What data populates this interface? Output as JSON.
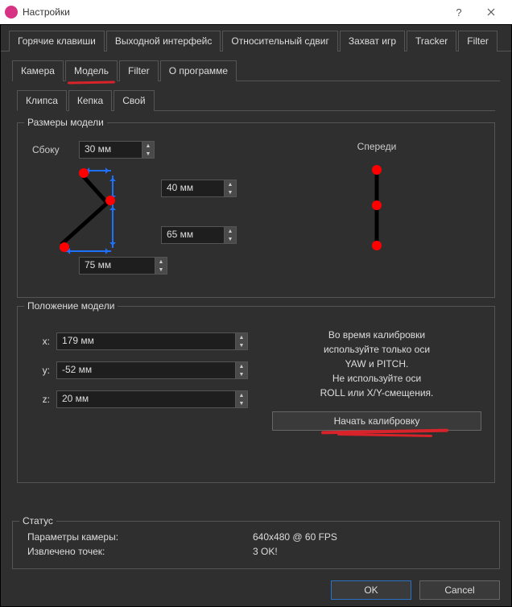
{
  "window": {
    "title": "Настройки"
  },
  "outerTabs": [
    "Горячие клавиши",
    "Выходной интерфейс",
    "Относительный сдвиг",
    "Захват игр",
    "Tracker",
    "Filter"
  ],
  "outerActiveIndex": 4,
  "innerTabs": [
    "Камера",
    "Модель",
    "Filter",
    "О программе"
  ],
  "innerActiveIndex": 1,
  "modelTabs": [
    "Клипса",
    "Кепка",
    "Свой"
  ],
  "modelActiveIndex": 0,
  "group_sizes_legend": "Размеры модели",
  "group_position_legend": "Положение модели",
  "labels": {
    "side": "Сбоку",
    "front": "Спереди",
    "x": "x:",
    "y": "y:",
    "z": "z:"
  },
  "sizes": {
    "side_top": "30 мм",
    "upper": "40 мм",
    "lower": "65 мм",
    "bottom": "75 мм"
  },
  "position": {
    "x": "179 мм",
    "y": "-52 мм",
    "z": "20 мм"
  },
  "calibration": {
    "line1": "Во время калибровки",
    "line2": "используйте только оси",
    "line3": "YAW и PITCH.",
    "line4": "Не используйте оси",
    "line5": "ROLL или X/Y-смещения.",
    "button": "Начать калибровку"
  },
  "status": {
    "legend": "Статус",
    "camera_params_label": "Параметры камеры:",
    "camera_params_value": "640x480 @ 60 FPS",
    "points_label": "Извлечено точек:",
    "points_value": "3 OK!"
  },
  "footer": {
    "ok": "OK",
    "cancel": "Cancel"
  }
}
